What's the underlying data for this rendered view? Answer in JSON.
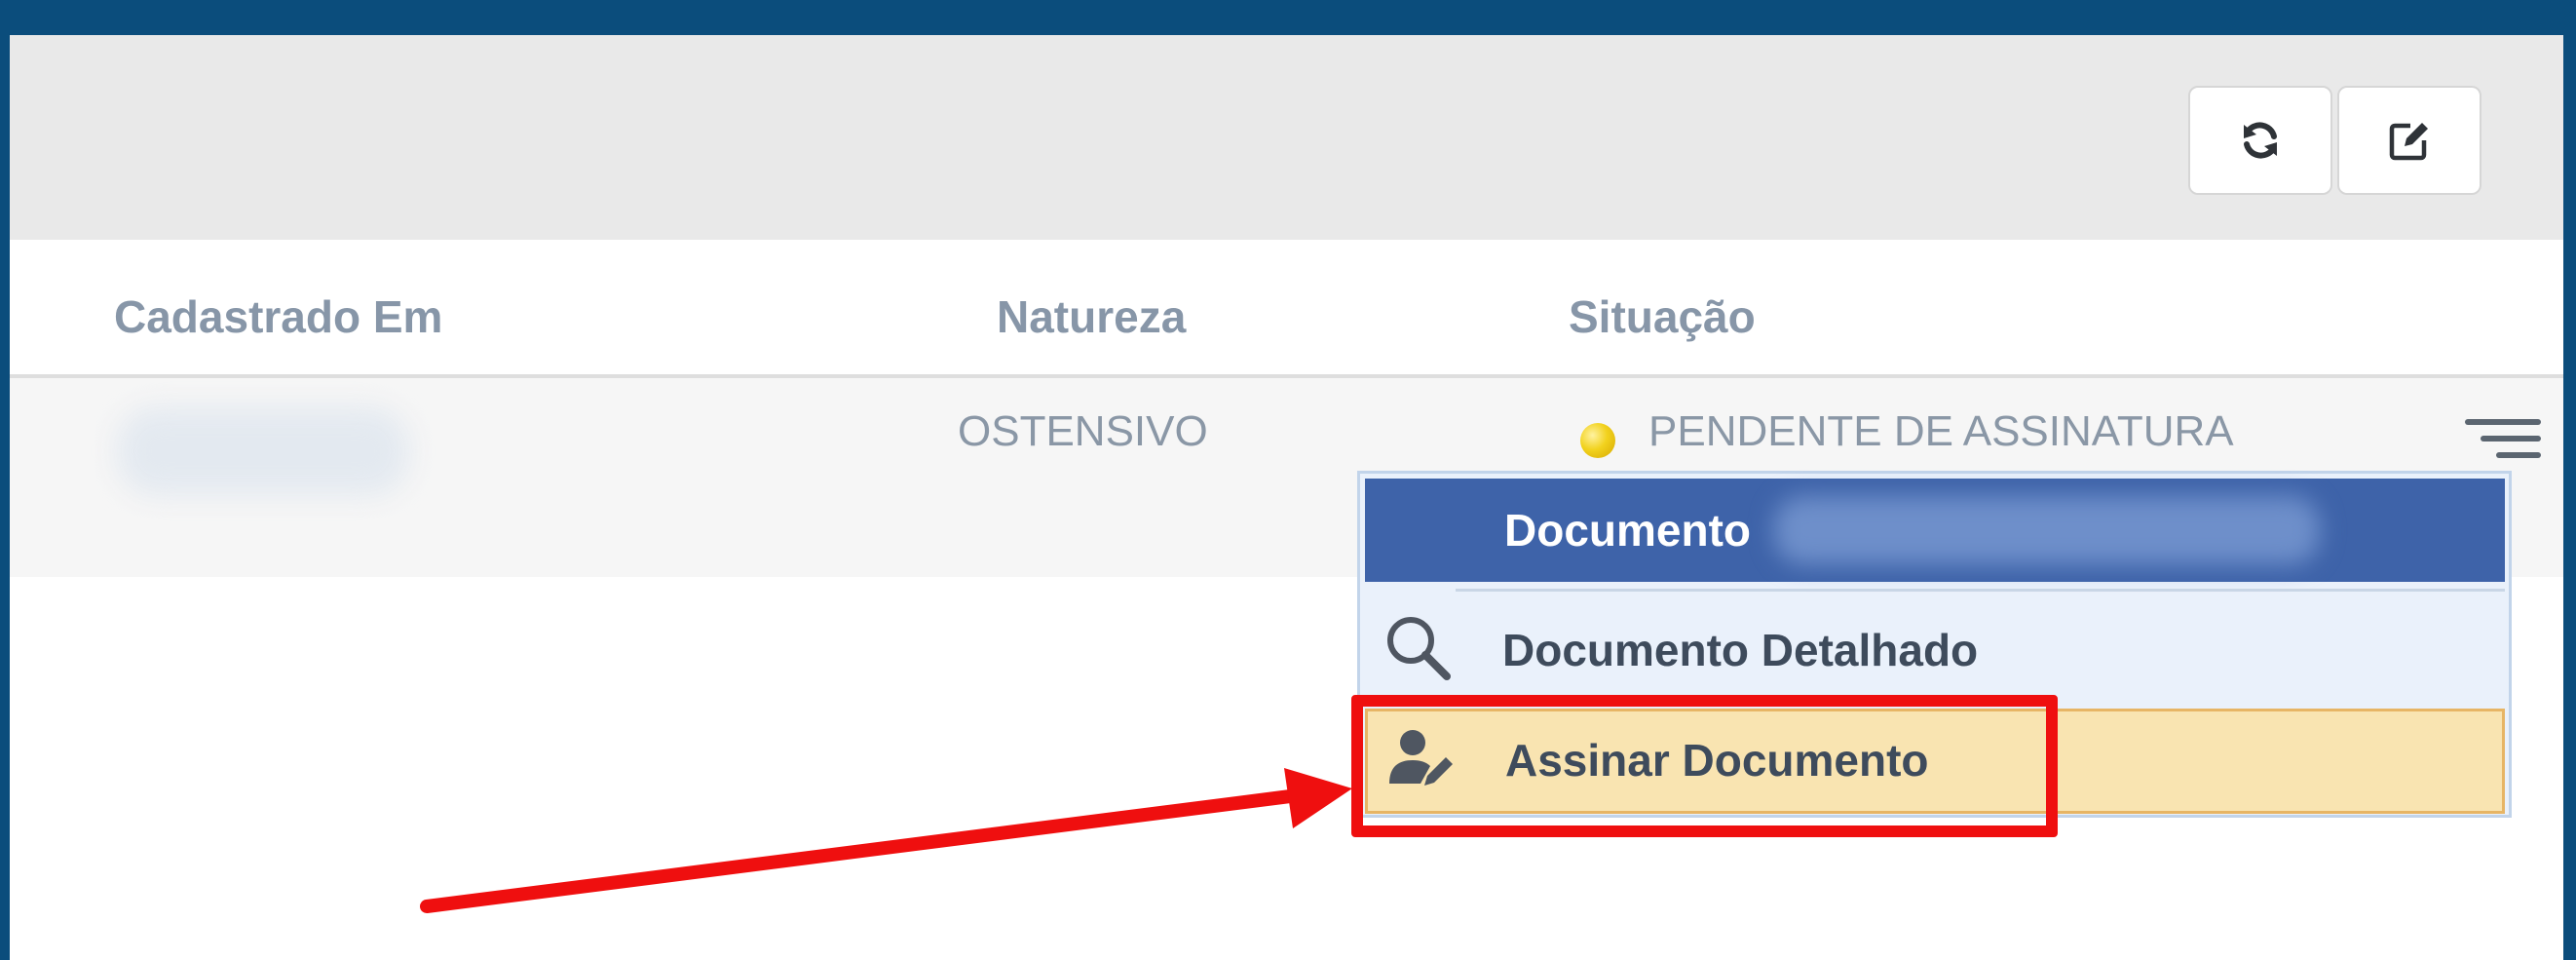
{
  "toolbar": {
    "refresh_icon": "refresh-icon",
    "edit_icon": "edit-icon"
  },
  "table": {
    "columns": [
      "Cadastrado Em",
      "Natureza",
      "Situação"
    ],
    "row": {
      "natureza": "OSTENSIVO",
      "situacao": "PENDENTE DE ASSINATURA",
      "status_color": "#f2d21e"
    }
  },
  "dropdown": {
    "header_label": "Documento",
    "items": [
      {
        "label": "Documento Detalhado",
        "icon": "search-icon"
      },
      {
        "label": "Assinar Documento",
        "icon": "user-sign-icon"
      }
    ]
  },
  "colors": {
    "frame": "#0b4d7c",
    "menu_header": "#3e63a9",
    "highlight": "#ef0f0f",
    "selected_item": "#f9e4b1"
  }
}
